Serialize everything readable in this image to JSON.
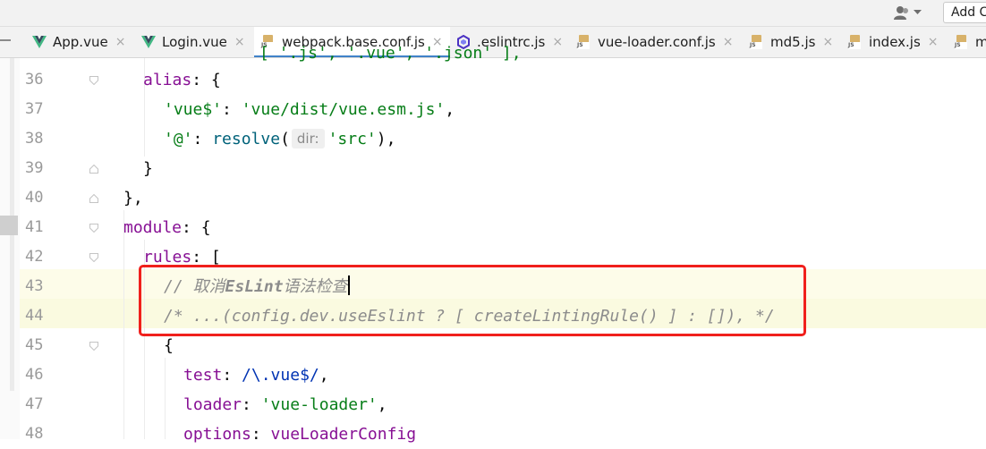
{
  "toolbar": {
    "add_label": "Add C",
    "user_icon": "user-icon"
  },
  "tabs": [
    {
      "label": "App.vue",
      "icon": "vue-icon",
      "active": false
    },
    {
      "label": "Login.vue",
      "icon": "vue-icon",
      "active": false
    },
    {
      "label": "webpack.base.conf.js",
      "icon": "js-file-icon",
      "active": true
    },
    {
      "label": ".eslintrc.js",
      "icon": "eslint-icon",
      "active": false
    },
    {
      "label": "vue-loader.conf.js",
      "icon": "js-file-icon",
      "active": false
    },
    {
      "label": "md5.js",
      "icon": "js-file-icon",
      "active": false
    },
    {
      "label": "index.js",
      "icon": "js-file-icon",
      "active": false
    },
    {
      "label": "m",
      "icon": "js-file-icon",
      "active": false
    }
  ],
  "close_glyph": "×",
  "editor": {
    "line_numbers": [
      "36",
      "37",
      "38",
      "39",
      "40",
      "41",
      "42",
      "43",
      "44",
      "45",
      "46",
      "47",
      "48"
    ],
    "lines": {
      "l36": {
        "key": "alias",
        "rest": ": {"
      },
      "l37": {
        "str1": "'vue$'",
        "colon": ": ",
        "str2": "'vue/dist/vue.esm.js'",
        "comma": ","
      },
      "l38": {
        "str1": "'@'",
        "colon": ": ",
        "fn": "resolve",
        "open": "(",
        "hint": "dir:",
        "str2": "'src'",
        "close": "),"
      },
      "l39": {
        "text": "}"
      },
      "l40": {
        "text": "},"
      },
      "l41": {
        "key": "module",
        "rest": ": {"
      },
      "l42": {
        "key": "rules",
        "rest": ": ["
      },
      "l43": {
        "prefix": "// 取消",
        "bold": "EsLint",
        "suffix": "语法检查"
      },
      "l44": {
        "text": "/* ...(config.dev.useEslint ? [ createLintingRule() ] : []), */"
      },
      "l45": {
        "text": "{"
      },
      "l46": {
        "key": "test",
        "colon": ": ",
        "regex": "/\\.vue$/",
        "comma": ","
      },
      "l47": {
        "key": "loader",
        "colon": ": ",
        "str": "'vue-loader'",
        "comma": ","
      },
      "l48": {
        "key": "options",
        "colon": ": ",
        "value": "vueLoaderConfig"
      }
    }
  },
  "highlight_color": "#f0201c"
}
